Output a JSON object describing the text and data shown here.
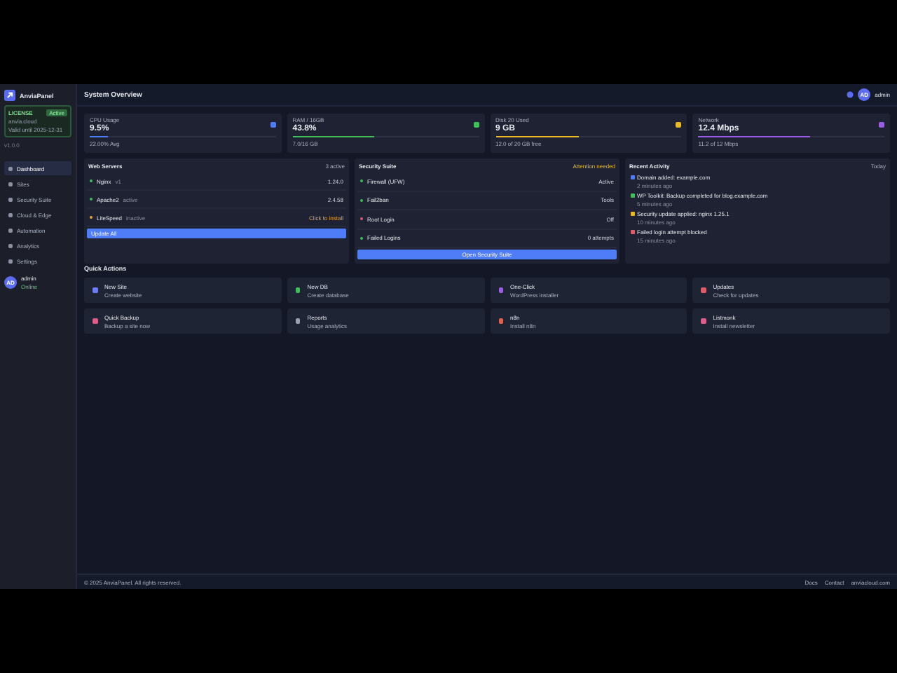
{
  "sidebar": {
    "brand": "AnviaPanel",
    "license": {
      "label": "LICENSE",
      "badge": "Active",
      "domain": "anvia.cloud",
      "note": "Valid until 2025-12-31"
    },
    "version": "v1.0.0",
    "items": [
      {
        "label": "Dashboard",
        "selected": true
      },
      {
        "label": "Sites",
        "selected": false
      },
      {
        "label": "Security Suite",
        "selected": false
      },
      {
        "label": "Cloud & Edge",
        "selected": false
      },
      {
        "label": "Automation",
        "selected": false
      },
      {
        "label": "Analytics",
        "selected": false
      },
      {
        "label": "Settings",
        "selected": false
      }
    ],
    "user": {
      "initials": "AD",
      "name": "admin",
      "status": "Online"
    }
  },
  "header": {
    "title": "System Overview",
    "user": {
      "initials": "AD",
      "name": "admin"
    }
  },
  "stats": [
    {
      "label": "CPU Usage",
      "value": "9.5%",
      "sub": "22.00% Avg",
      "level": 0.095,
      "color": "#4f7cf7"
    },
    {
      "label": "RAM / 16GB",
      "value": "43.8%",
      "sub": "7.0/16 GB",
      "level": 0.44,
      "color": "#3fbf5a"
    },
    {
      "label": "Disk 20 Used",
      "value": "9 GB",
      "sub": "12.0 of 20 GB free",
      "level": 0.45,
      "color": "#e8b923"
    },
    {
      "label": "Network",
      "value": "12.4 Mbps",
      "sub": "11.2 of 12 Mbps",
      "level": 0.6,
      "color": "#9b5de5"
    }
  ],
  "web_servers": {
    "title": "Web Servers",
    "badge": "3 active",
    "rows": [
      {
        "name": "Nginx",
        "tag": "v1",
        "value": "1.24.0",
        "color": "#3fbf5a"
      },
      {
        "name": "Apache2",
        "tag": "active",
        "value": "2.4.58",
        "color": "#3fbf5a"
      },
      {
        "name": "LiteSpeed",
        "tag": "inactive",
        "value": "Click to install",
        "color": "#e8a23a"
      }
    ],
    "button": "Update All"
  },
  "security": {
    "title": "Security Suite",
    "badge": "Attention needed",
    "rows": [
      {
        "name": "Firewall (UFW)",
        "value": "Active",
        "color": "#3fbf5a"
      },
      {
        "name": "Fail2ban",
        "value": "Tools",
        "color": "#3fbf5a"
      },
      {
        "name": "Root Login",
        "value": "Off",
        "color": "#e05a6a"
      },
      {
        "name": "Failed Logins",
        "value": "0 attempts",
        "color": "#3fbf5a"
      }
    ],
    "button": "Open Security Suite"
  },
  "activity": {
    "title": "Recent Activity",
    "badge": "Today",
    "items": [
      {
        "text": "Domain added: example.com",
        "time": "2 minutes ago",
        "color": "#4f7cf7"
      },
      {
        "text": "WP Toolkit: Backup completed for blog.example.com",
        "time": "5 minutes ago",
        "color": "#3fbf5a"
      },
      {
        "text": "Security update applied: nginx 1.25.1",
        "time": "10 minutes ago",
        "color": "#e8b923"
      },
      {
        "text": "Failed login attempt blocked",
        "time": "15 minutes ago",
        "color": "#e05a6a"
      }
    ]
  },
  "quick_actions": {
    "title": "Quick Actions",
    "items": [
      {
        "title": "New Site",
        "sub": "Create website",
        "color": "#6b7cf7"
      },
      {
        "title": "New DB",
        "sub": "Create database",
        "color": "#3fbf5a"
      },
      {
        "title": "One-Click",
        "sub": "WordPress installer",
        "color": "#9b5de5"
      },
      {
        "title": "Updates",
        "sub": "Check for updates",
        "color": "#e05a6a"
      },
      {
        "title": "Quick Backup",
        "sub": "Backup a site now",
        "color": "#e05a8a"
      },
      {
        "title": "Reports",
        "sub": "Usage analytics",
        "color": "#9aa0b0"
      },
      {
        "title": "n8n",
        "sub": "Install n8n",
        "color": "#e0604a"
      },
      {
        "title": "Listmonk",
        "sub": "Install newsletter",
        "color": "#e05a8a"
      }
    ]
  },
  "footer": {
    "copyright": "© 2025 AnviaPanel. All rights reserved.",
    "links": [
      "Docs",
      "Contact",
      "anviacloud.com"
    ]
  }
}
